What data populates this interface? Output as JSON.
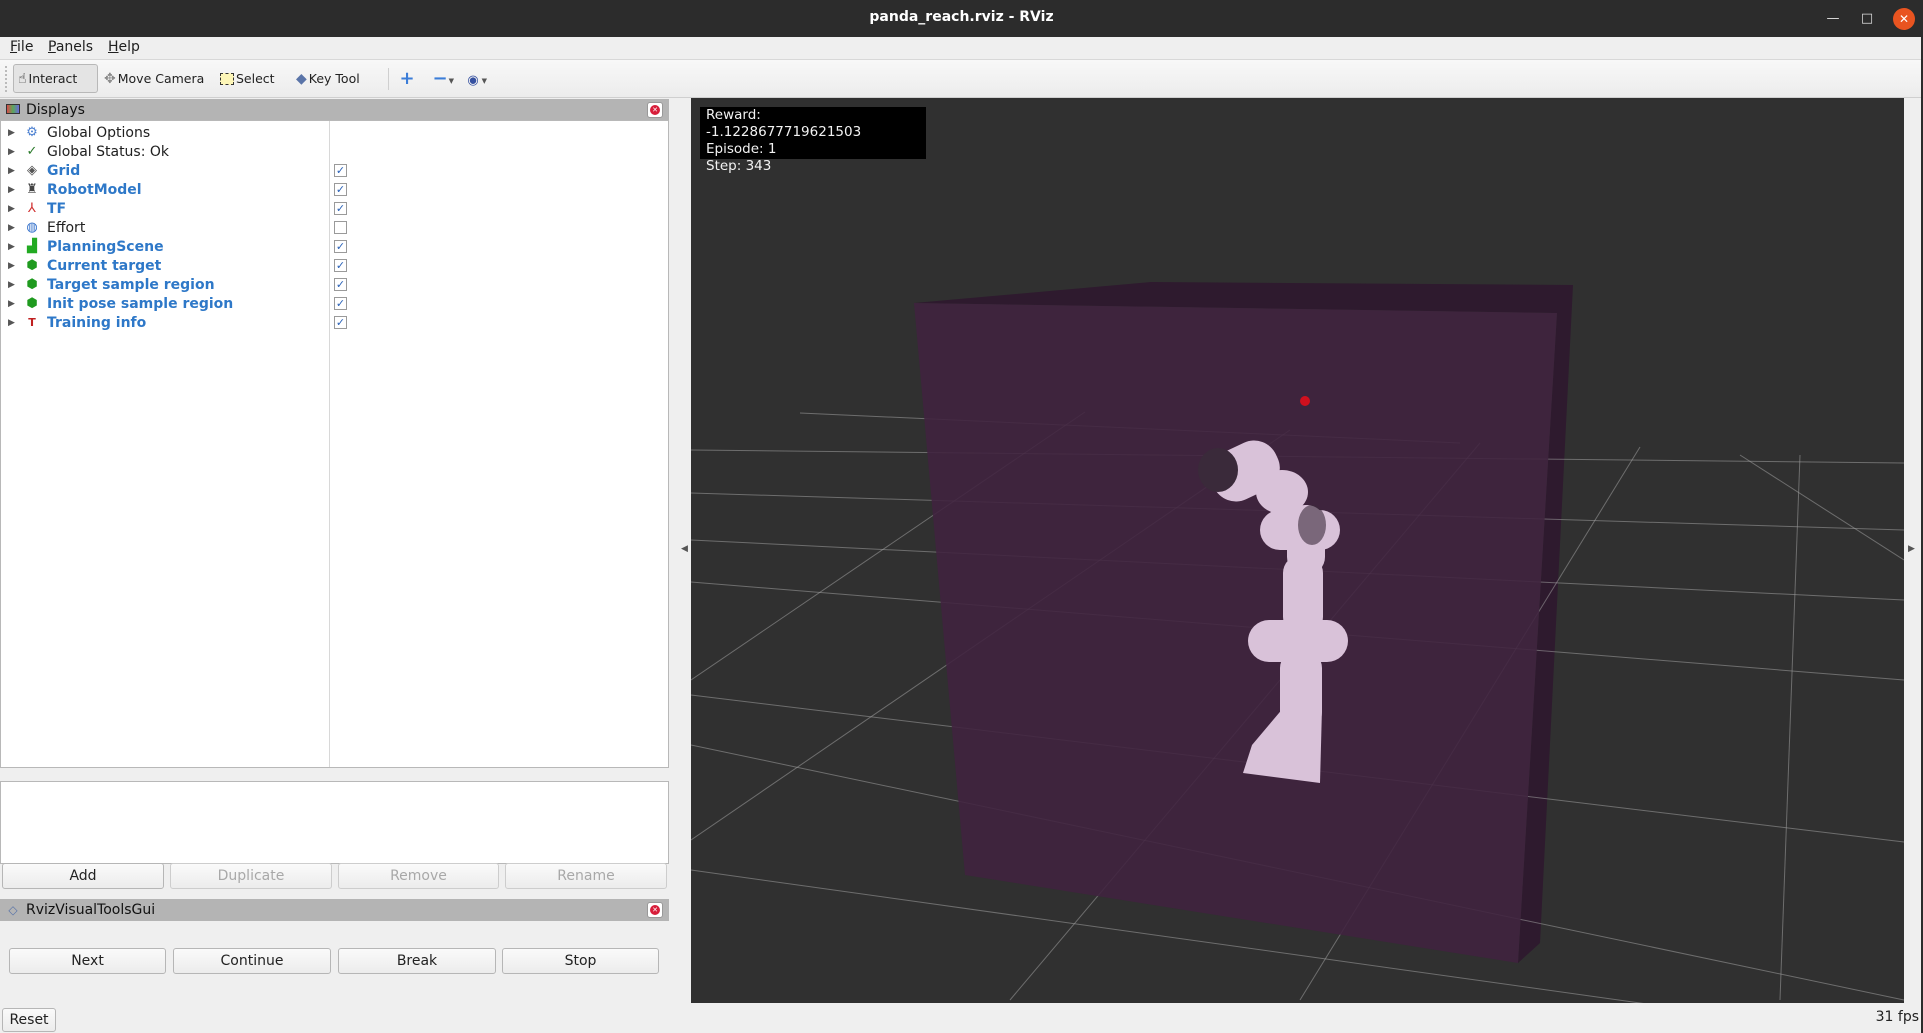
{
  "window": {
    "title": "panda_reach.rviz - RViz",
    "controls": {
      "minimize": "—",
      "maximize": "□",
      "close": "✕"
    }
  },
  "menubar": [
    {
      "label": "File",
      "accel": "F",
      "rest": "ile"
    },
    {
      "label": "Panels",
      "accel": "P",
      "rest": "anels"
    },
    {
      "label": "Help",
      "accel": "H",
      "rest": "elp"
    }
  ],
  "toolbar": {
    "tools": [
      {
        "label": "Interact",
        "icon": "hand-icon",
        "active": true
      },
      {
        "label": "Move Camera",
        "icon": "move-camera-icon",
        "active": false
      },
      {
        "label": "Select",
        "icon": "select-icon",
        "active": false
      },
      {
        "label": "Key Tool",
        "icon": "key-tool-icon",
        "active": false
      }
    ],
    "extra_icons": [
      "add-tool-icon",
      "remove-tool-icon",
      "view-icon"
    ]
  },
  "displays_panel": {
    "title": "Displays",
    "items": [
      {
        "label": "Global Options",
        "icon": "gear-icon",
        "enabled_style": false,
        "checkbox": null
      },
      {
        "label": "Global Status: Ok",
        "icon": "check-icon",
        "enabled_style": false,
        "checkbox": null
      },
      {
        "label": "Grid",
        "icon": "grid-icon",
        "enabled_style": true,
        "checkbox": true
      },
      {
        "label": "RobotModel",
        "icon": "robot-model-icon",
        "enabled_style": true,
        "checkbox": true
      },
      {
        "label": "TF",
        "icon": "tf-axes-icon",
        "enabled_style": true,
        "checkbox": true
      },
      {
        "label": "Effort",
        "icon": "effort-icon",
        "enabled_style": false,
        "checkbox": false
      },
      {
        "label": "PlanningScene",
        "icon": "planning-scene-icon",
        "enabled_style": true,
        "checkbox": true
      },
      {
        "label": "Current target",
        "icon": "marker-cube-icon",
        "enabled_style": true,
        "checkbox": true
      },
      {
        "label": "Target sample region",
        "icon": "marker-cube-icon",
        "enabled_style": true,
        "checkbox": true
      },
      {
        "label": "Init pose sample region",
        "icon": "marker-cube-icon",
        "enabled_style": true,
        "checkbox": true
      },
      {
        "label": "Training info",
        "icon": "overlay-text-icon",
        "enabled_style": true,
        "checkbox": true
      }
    ],
    "buttons": [
      {
        "label": "Add",
        "disabled": false
      },
      {
        "label": "Duplicate",
        "disabled": true
      },
      {
        "label": "Remove",
        "disabled": true
      },
      {
        "label": "Rename",
        "disabled": true
      }
    ]
  },
  "visual_tools_panel": {
    "title": "RvizVisualToolsGui",
    "buttons": [
      "Next",
      "Continue",
      "Break",
      "Stop"
    ]
  },
  "reset_label": "Reset",
  "viewport": {
    "overlay_lines": [
      "Reward: -1.1228677719621503",
      "Episode: 1",
      "Step: 343"
    ],
    "colors": {
      "background": "#303030",
      "region_box": "#40223f",
      "region_box_side": "#2e1a2e",
      "grid": "#a0a0a0",
      "robot": "#d9c2d9",
      "target": "#d0101e"
    }
  },
  "status": {
    "fps": "31 fps"
  }
}
